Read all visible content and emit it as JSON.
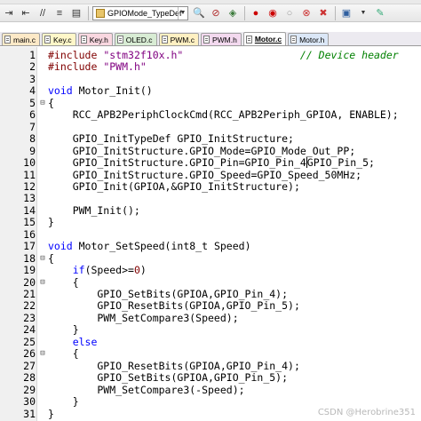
{
  "toolbar": {
    "function_combo": "GPIOMode_TypeDef"
  },
  "tabs": [
    {
      "label": "main.c",
      "color": "#fde9c7"
    },
    {
      "label": "Key.c",
      "color": "#fff7c9"
    },
    {
      "label": "Key.h",
      "color": "#f9d7e0"
    },
    {
      "label": "OLED.c",
      "color": "#d8ecd4"
    },
    {
      "label": "PWM.c",
      "color": "#fff0c2"
    },
    {
      "label": "PWM.h",
      "color": "#f3d9ef"
    },
    {
      "label": "Motor.c",
      "color": "#ffffff"
    },
    {
      "label": "Motor.h",
      "color": "#dbe7f7"
    }
  ],
  "editor": {
    "lines": [
      {
        "n": "1",
        "fold": "",
        "html": "<span class='pp'>#include</span> <span class='s'>\"stm32f10x.h\"</span>                   <span class='c'>// Device header</span>"
      },
      {
        "n": "2",
        "fold": "",
        "html": "<span class='pp'>#include</span> <span class='s'>\"PWM.h\"</span>"
      },
      {
        "n": "3",
        "fold": "",
        "html": ""
      },
      {
        "n": "4",
        "fold": "",
        "html": "<span class='k'>void</span> Motor_Init()"
      },
      {
        "n": "5",
        "fold": "⊟",
        "html": "{"
      },
      {
        "n": "6",
        "fold": "",
        "html": "    RCC_APB2PeriphClockCmd(RCC_APB2Periph_GPIOA, ENABLE);"
      },
      {
        "n": "7",
        "fold": "",
        "html": ""
      },
      {
        "n": "8",
        "fold": "",
        "html": "    GPIO_InitTypeDef GPIO_InitStructure;"
      },
      {
        "n": "9",
        "fold": "",
        "html": "    GPIO_InitStructure.GPIO_Mode=GPIO_Mode_Out_PP;"
      },
      {
        "n": "10",
        "fold": "",
        "html": "    GPIO_InitStructure.GPIO_Pin=GPIO_Pin_4<span class='cursor-bar'></span>GPIO_Pin_5;"
      },
      {
        "n": "11",
        "fold": "",
        "html": "    GPIO_InitStructure.GPIO_Speed=GPIO_Speed_50MHz;"
      },
      {
        "n": "12",
        "fold": "",
        "html": "    GPIO_Init(GPIOA,&amp;GPIO_InitStructure);"
      },
      {
        "n": "13",
        "fold": "",
        "html": ""
      },
      {
        "n": "14",
        "fold": "",
        "html": "    PWM_Init();"
      },
      {
        "n": "15",
        "fold": "",
        "html": "}"
      },
      {
        "n": "16",
        "fold": "",
        "html": ""
      },
      {
        "n": "17",
        "fold": "",
        "html": "<span class='k'>void</span> Motor_SetSpeed(int8_t Speed)"
      },
      {
        "n": "18",
        "fold": "⊟",
        "html": "{"
      },
      {
        "n": "19",
        "fold": "",
        "html": "    <span class='k'>if</span>(Speed&gt;=<span class='n'>0</span>)"
      },
      {
        "n": "20",
        "fold": "⊟",
        "html": "    {"
      },
      {
        "n": "21",
        "fold": "",
        "html": "        GPIO_SetBits(GPIOA,GPIO_Pin_4);"
      },
      {
        "n": "22",
        "fold": "",
        "html": "        GPIO_ResetBits(GPIOA,GPIO_Pin_5);"
      },
      {
        "n": "23",
        "fold": "",
        "html": "        PWM_SetCompare3(Speed);"
      },
      {
        "n": "24",
        "fold": "",
        "html": "    }"
      },
      {
        "n": "25",
        "fold": "",
        "html": "    <span class='k'>else</span>"
      },
      {
        "n": "26",
        "fold": "⊟",
        "html": "    {"
      },
      {
        "n": "27",
        "fold": "",
        "html": "        GPIO_ResetBits(GPIOA,GPIO_Pin_4);"
      },
      {
        "n": "28",
        "fold": "",
        "html": "        GPIO_SetBits(GPIOA,GPIO_Pin_5);"
      },
      {
        "n": "29",
        "fold": "",
        "html": "        PWM_SetCompare3(-Speed);"
      },
      {
        "n": "30",
        "fold": "",
        "html": "    }"
      },
      {
        "n": "31",
        "fold": "",
        "html": "}"
      }
    ]
  },
  "watermark": "CSDN @Herobrine351"
}
